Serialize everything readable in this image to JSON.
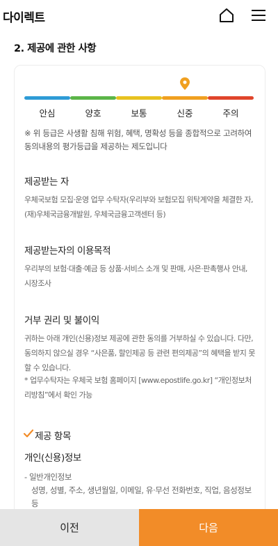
{
  "header": {
    "title": "다이렉트",
    "home_icon": "home-icon",
    "menu_icon": "hamburger-menu-icon"
  },
  "section": {
    "title": "2. 제공에 관한 사항"
  },
  "grade": {
    "current": "신중",
    "pin_color": "#f0a020",
    "levels": [
      {
        "label": "안심",
        "color": "#2e9bd6"
      },
      {
        "label": "양호",
        "color": "#5bb548"
      },
      {
        "label": "보통",
        "color": "#e8c21f"
      },
      {
        "label": "신중",
        "color": "#f0a020"
      },
      {
        "label": "주의",
        "color": "#e0452b"
      }
    ],
    "note": "※ 위 등급은 사생활 침해 위험, 혜택, 명확성 등을 종합적으로 고려하여 동의내용의 평가등급을 제공하는 제도입니다"
  },
  "recipient": {
    "heading": "제공받는 자",
    "text": "우체국보험 모집·운영 업무 수탁자(우리부와 보험모집 위탁계약을 체결한 자, (재)우체국금융개발원, 우체국금융고객센터 등)"
  },
  "purpose": {
    "heading": "제공받는자의 이용목적",
    "text": "우리부의 보험·대출·예금 등 상품·서비스 소개 및 판매, 사은·판촉행사 안내, 시장조사"
  },
  "refusal": {
    "heading": "거부 권리 및 불이익",
    "line1": "귀하는 아래 개인(신용)정보 제공에 관한 동의를 거부하실 수 있습니다. 다만, 동의하지 않으실 경우 “사은품, 할인제공 등 관련 편의제공”의 혜택을 받지 못할 수 있습니다.",
    "line2": "* 업무수탁자는 우체국 보험 홈페이지 [www.epostlife.go.kr] “개인정보처리방침”에서 확인 가능"
  },
  "items": {
    "heading": "제공 항목",
    "subheading": "개인(신용)정보",
    "general_label": "- 일반개인정보",
    "general_detail": "성명, 성별, 주소, 생년월일, 이메일, 유·무선 전화번호, 직업, 음성정보 등"
  },
  "footer": {
    "prev": "이전",
    "next": "다음"
  },
  "colors": {
    "accent": "#f28c28",
    "prev_bg": "#e5e5e5"
  }
}
